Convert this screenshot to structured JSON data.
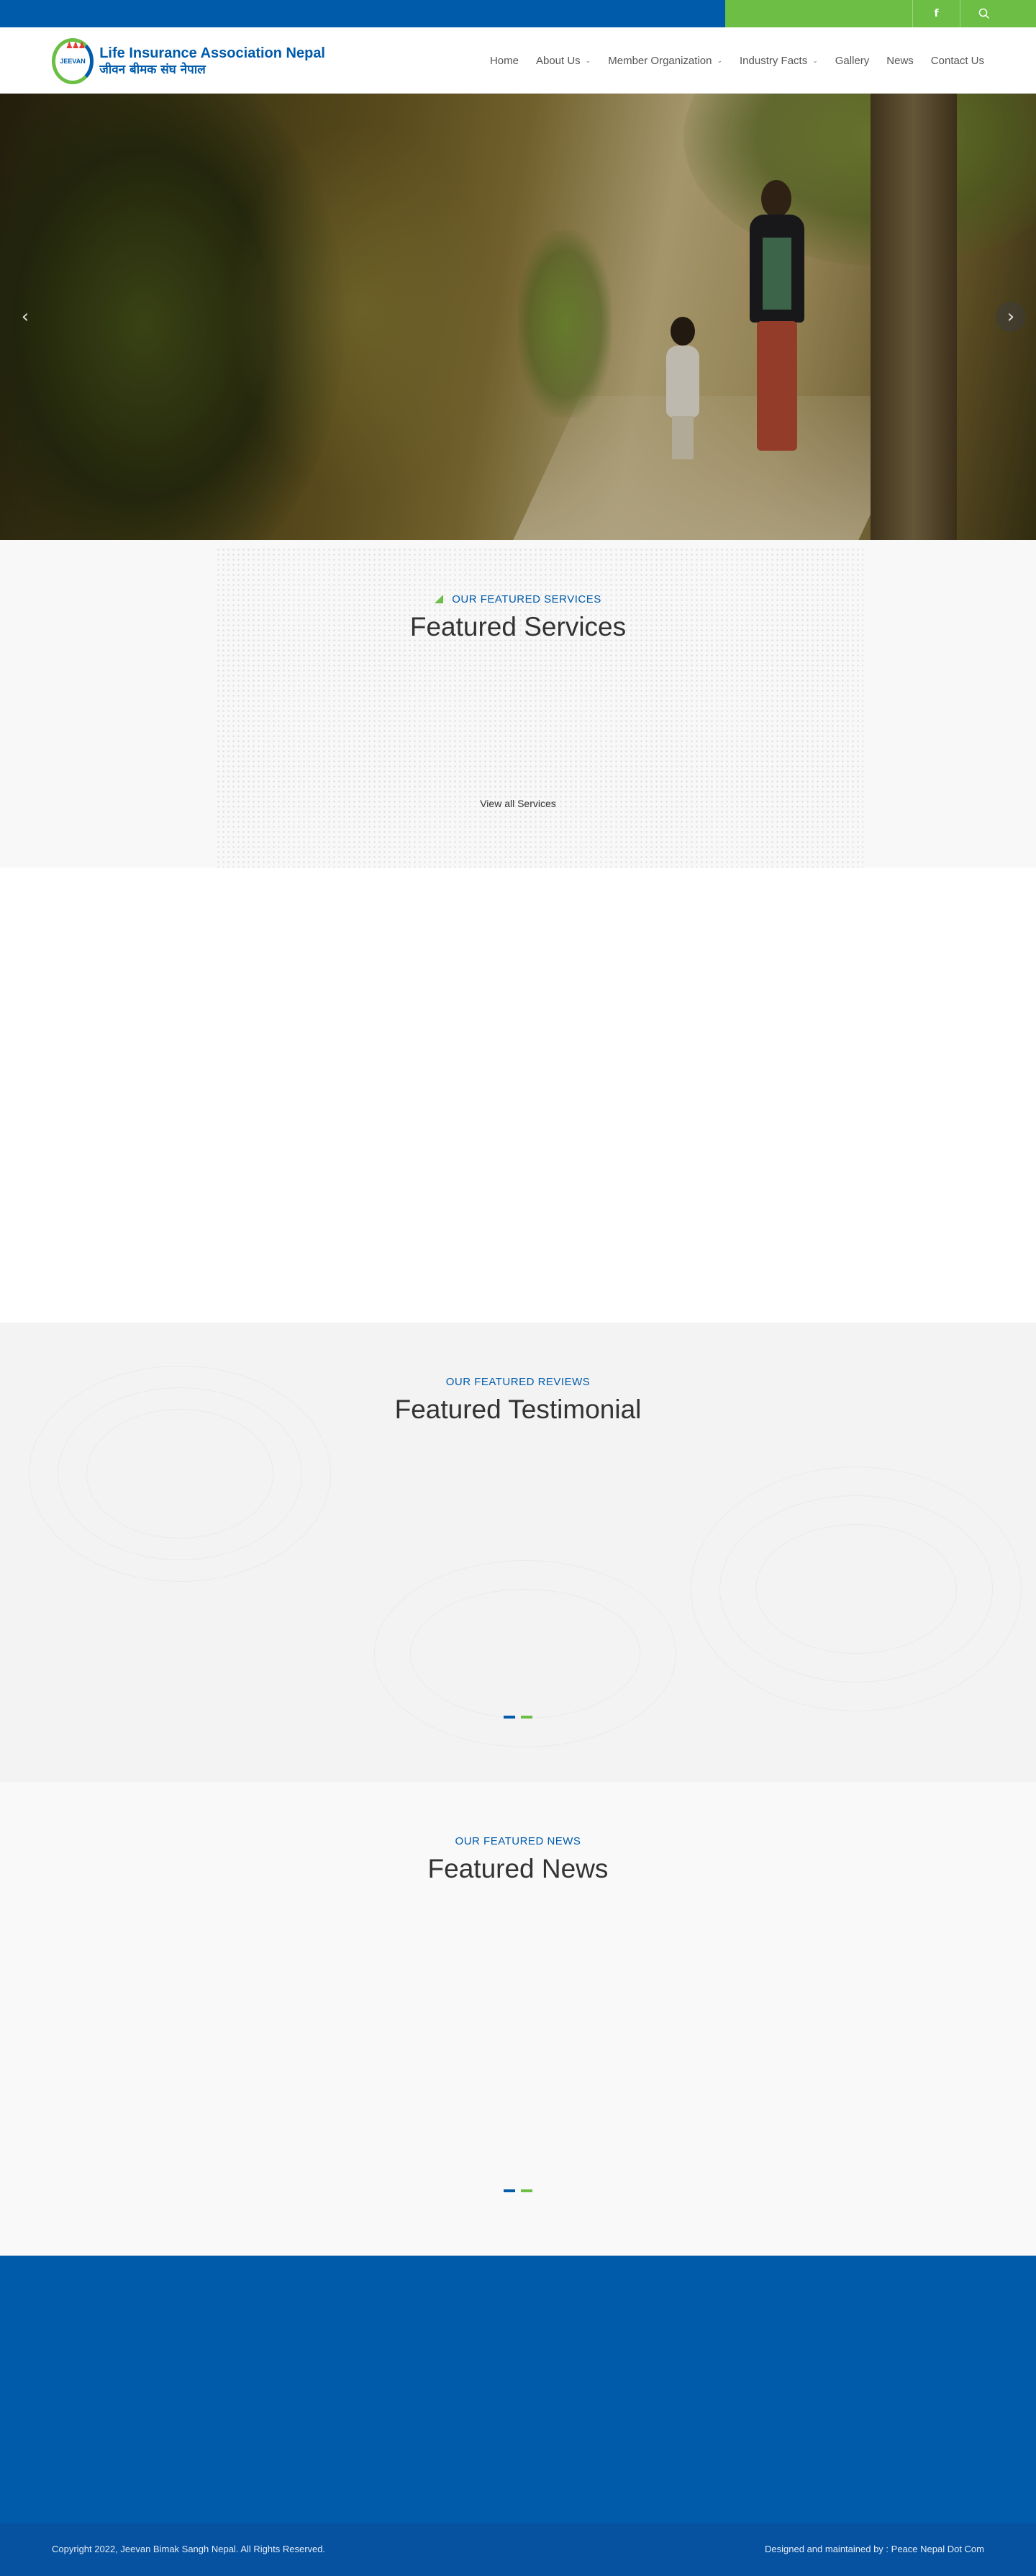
{
  "topbar": {
    "facebook_icon": "facebook-icon",
    "facebook_glyph": "f",
    "search_icon": "search-icon",
    "search_glyph": "⌕"
  },
  "header": {
    "logo_badge": "JEEVAN",
    "logo_title_en": "Life Insurance Association Nepal",
    "logo_title_np": "जीवन बीमक संघ नेपाल"
  },
  "nav": {
    "items": [
      {
        "label": "Home",
        "has_dropdown": false
      },
      {
        "label": "About Us",
        "has_dropdown": true
      },
      {
        "label": "Member Organization",
        "has_dropdown": true
      },
      {
        "label": "Industry Facts",
        "has_dropdown": true
      },
      {
        "label": "Gallery",
        "has_dropdown": false
      },
      {
        "label": "News",
        "has_dropdown": false
      },
      {
        "label": "Contact Us",
        "has_dropdown": false
      }
    ],
    "chevron": "⌄"
  },
  "hero": {
    "prev_glyph": "‹",
    "next_glyph": "›"
  },
  "services": {
    "subtitle": "OUR FEATURED SERVICES",
    "title": "Featured Services",
    "view_all": "View all Services"
  },
  "testimonial": {
    "subtitle": "OUR FEATURED REVIEWS",
    "title": "Featured Testimonial"
  },
  "news": {
    "subtitle": "OUR FEATURED NEWS",
    "title": "Featured News"
  },
  "footer": {
    "copyright": "Copyright 2022, Jeevan Bimak Sangh Nepal. All Rights Reserved.",
    "credit": "Designed and maintained by : Peace Nepal Dot Com"
  },
  "colors": {
    "primary_blue": "#005bab",
    "accent_green": "#6cbe45"
  }
}
